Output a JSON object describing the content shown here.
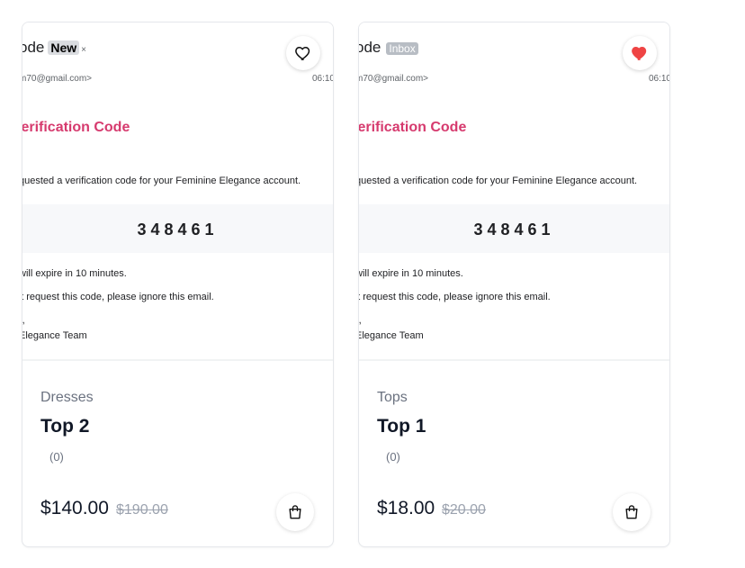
{
  "products": [
    {
      "image": {
        "subject": "ode",
        "tag": "New",
        "tag_close": "×",
        "from": "m70@gmail.com>",
        "time": "06:10",
        "title": "/erification Code",
        "line1": "quested a verification code for your Feminine Elegance account.",
        "code": "348461",
        "line2": "will expire in 10 minutes.",
        "line3": "'t request this code, please ignore this email.",
        "line4": "),",
        "line5": "Elegance Team"
      },
      "favorited": false,
      "category": "Dresses",
      "name": "Top 2",
      "rating": "(0)",
      "price": "$140.00",
      "old_price": "$190.00"
    },
    {
      "image": {
        "subject": "ode",
        "tag": "Inbox",
        "tag_close": "",
        "from": "m70@gmail.com>",
        "time": "06:10",
        "title": "/erification Code",
        "line1": "quested a verification code for your Feminine Elegance account.",
        "code": "348461",
        "line2": "will expire in 10 minutes.",
        "line3": "'t request this code, please ignore this email.",
        "line4": "),",
        "line5": "Elegance Team"
      },
      "favorited": true,
      "category": "Tops",
      "name": "Top 1",
      "rating": "(0)",
      "price": "$18.00",
      "old_price": "$20.00"
    }
  ],
  "colors": {
    "heart_active": "#ef4444",
    "accent_title": "#d63a6e"
  },
  "icons": {
    "favorite": "heart-icon",
    "cart": "shopping-bag-icon"
  }
}
